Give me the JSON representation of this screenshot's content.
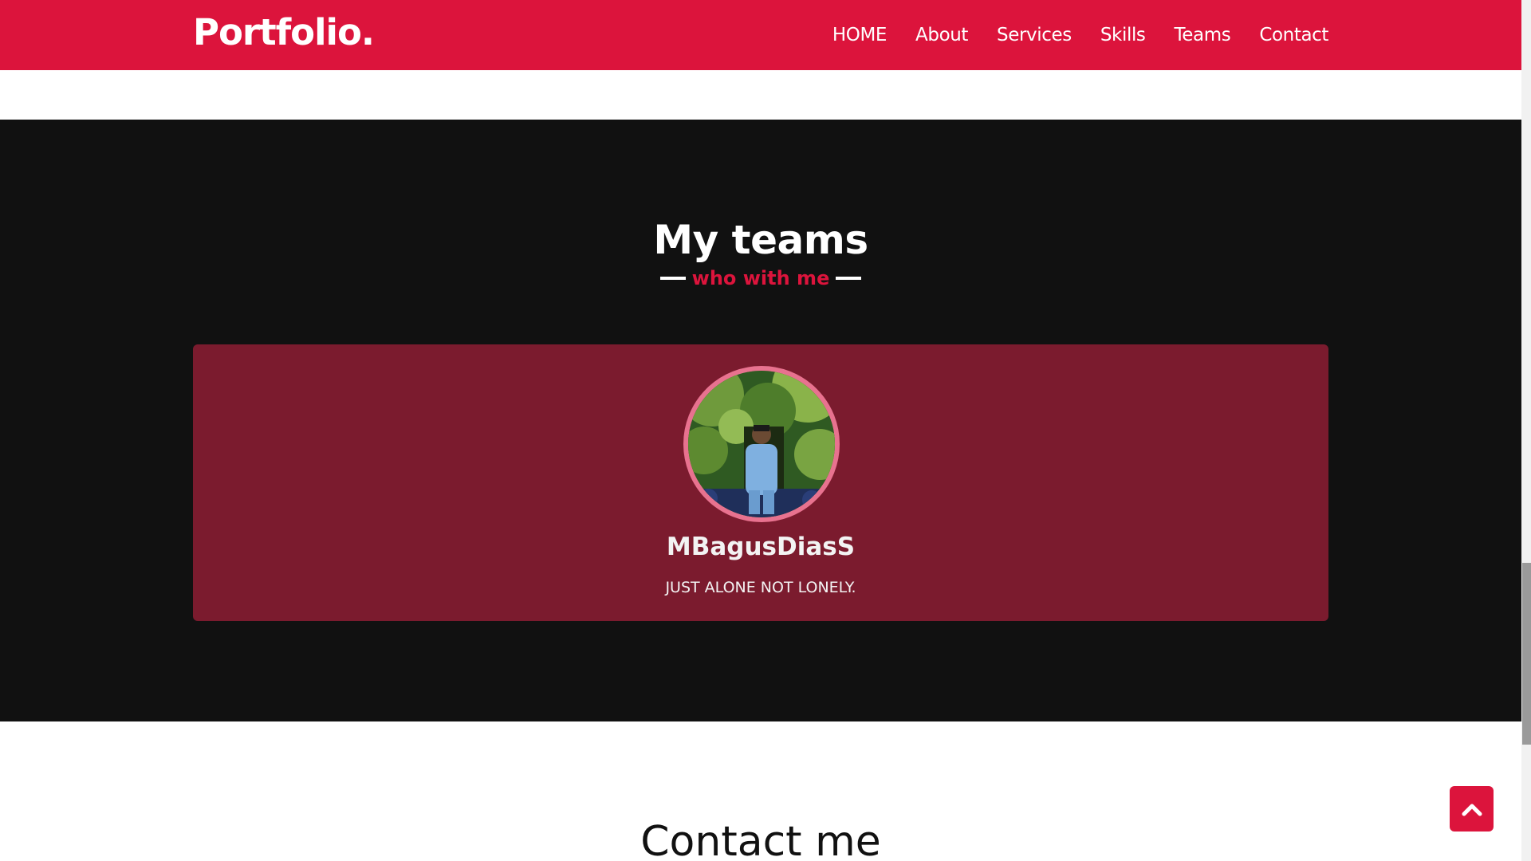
{
  "brand": {
    "logo": "Portfolio."
  },
  "nav": {
    "items": [
      {
        "label": "HOME"
      },
      {
        "label": "About"
      },
      {
        "label": "Services"
      },
      {
        "label": "Skills"
      },
      {
        "label": "Teams"
      },
      {
        "label": "Contact"
      }
    ]
  },
  "teams": {
    "title": "My teams",
    "subtitle": "who with me",
    "members": [
      {
        "name": "MBagusDiasS",
        "tagline": "JUST ALONE NOT LONELY."
      }
    ]
  },
  "contact": {
    "title": "Contact me"
  },
  "scroll_top": {
    "icon": "chevron-up-icon"
  },
  "colors": {
    "accent": "#dc143c",
    "teams_bg": "#111111",
    "card_bg": "#7b1b2e",
    "avatar_border": "#e8728f"
  }
}
